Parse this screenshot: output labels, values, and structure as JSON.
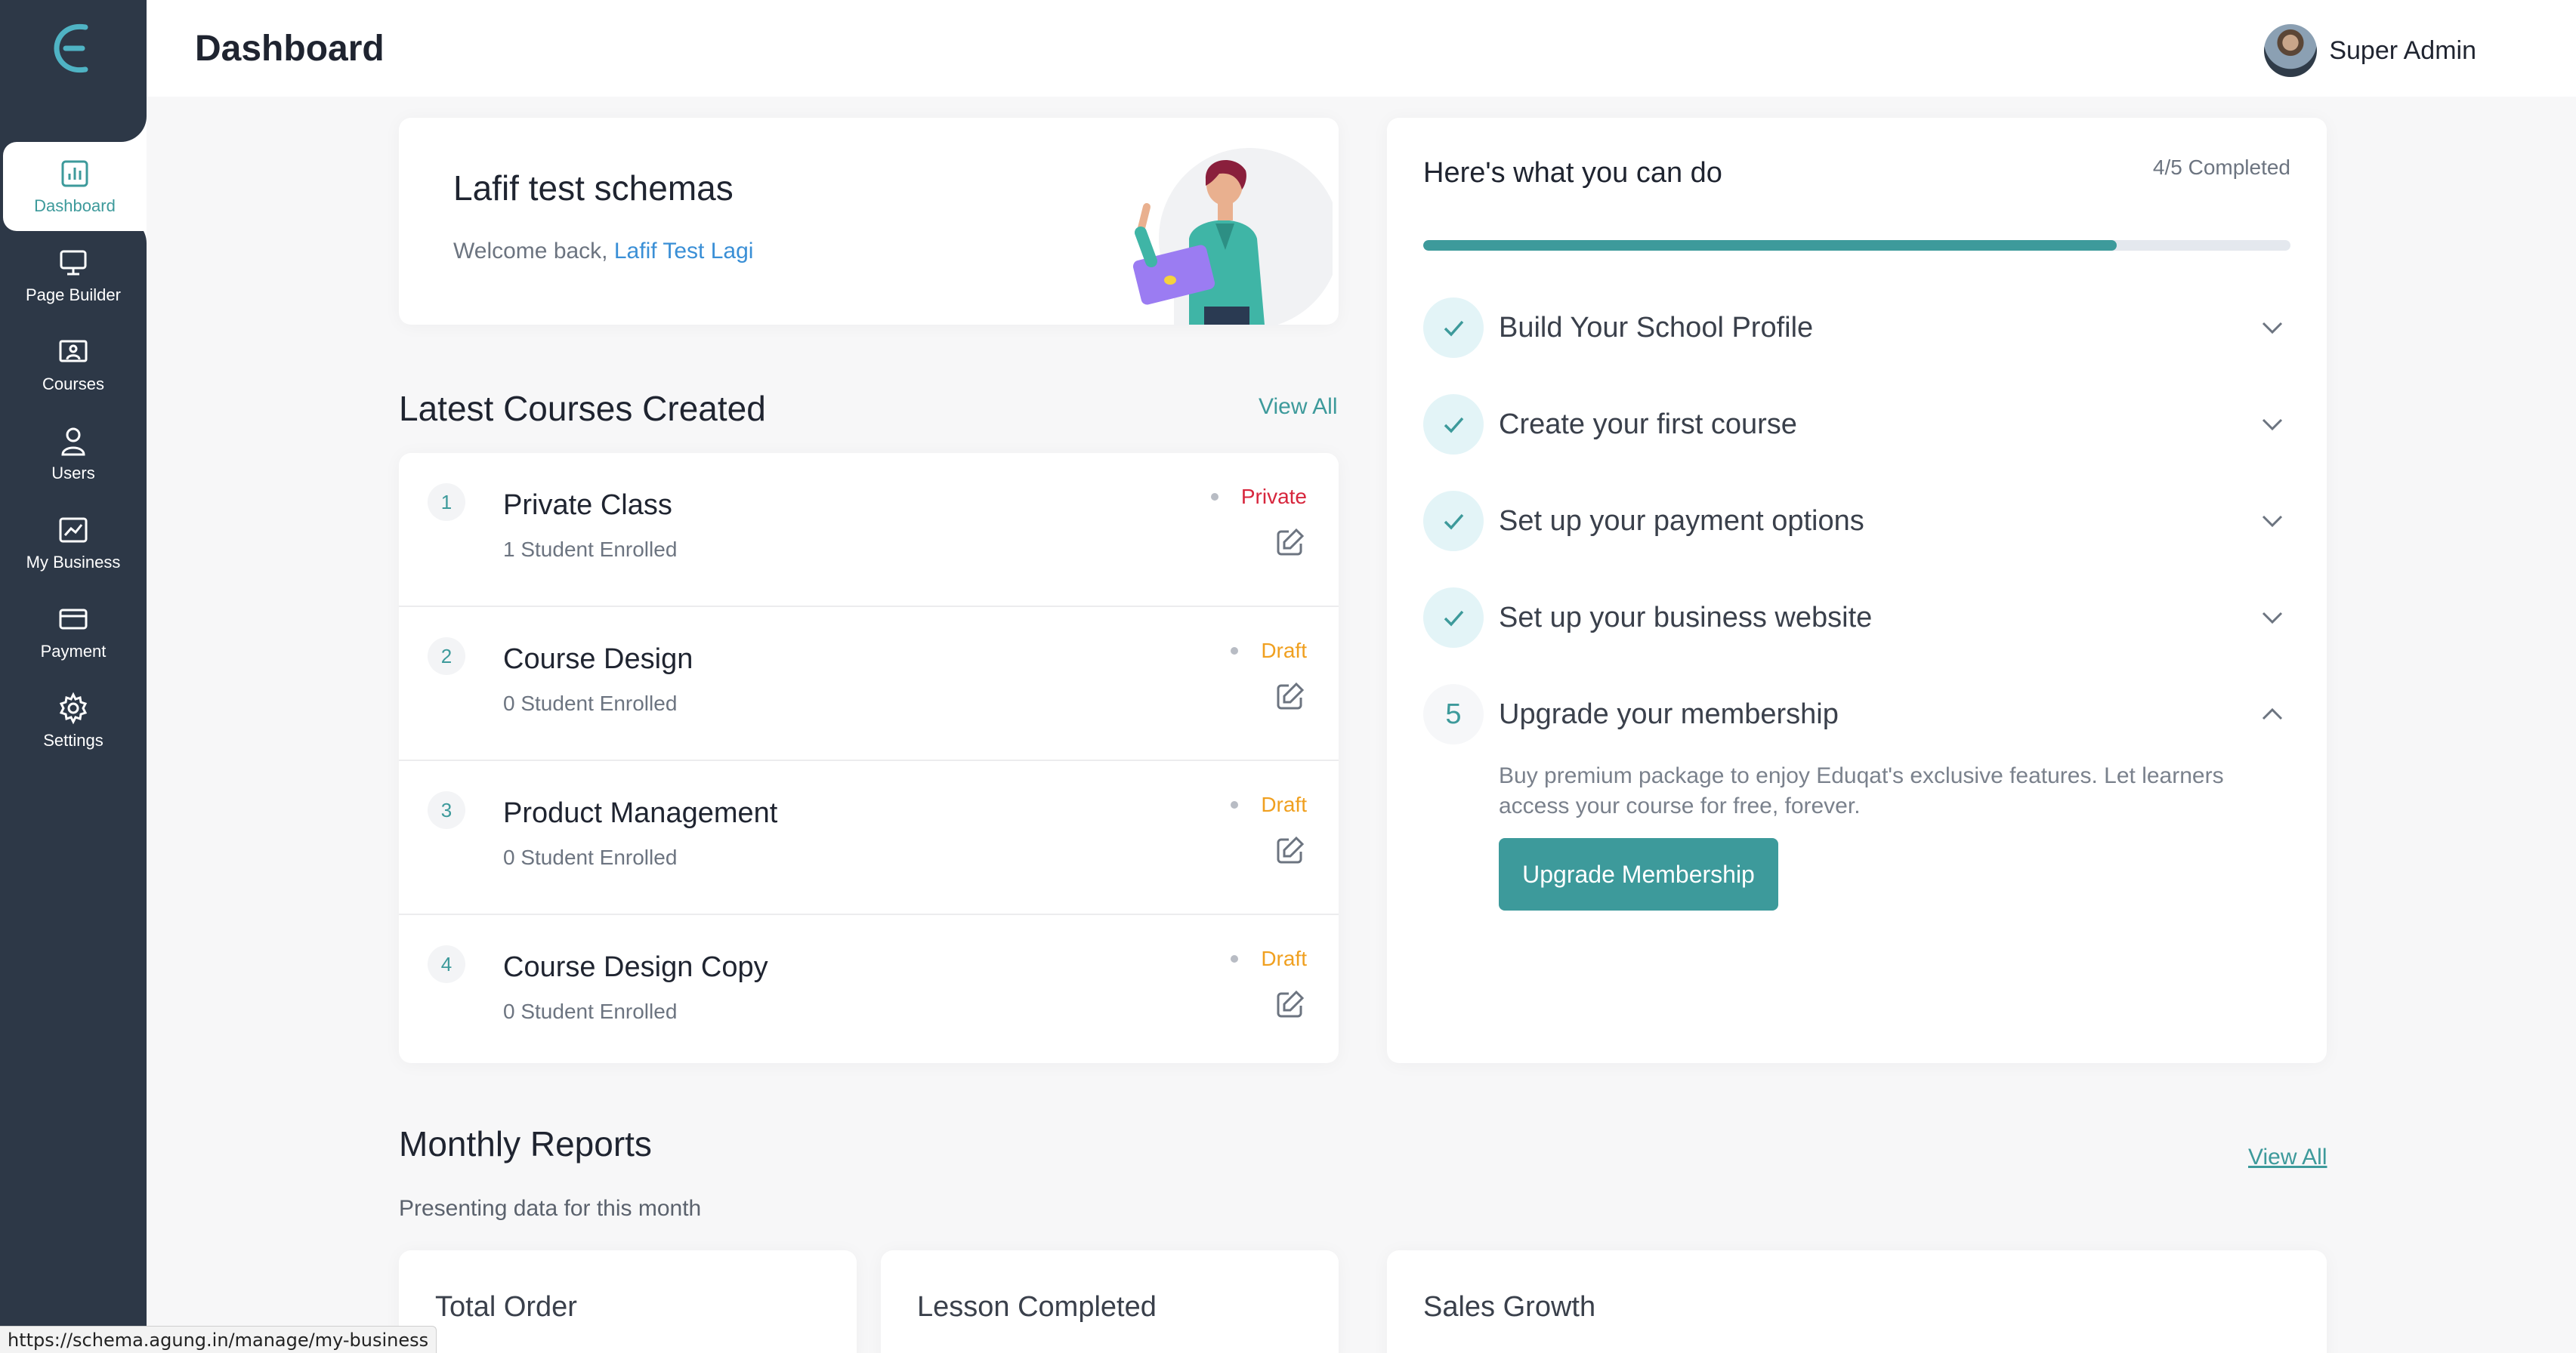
{
  "header": {
    "title": "Dashboard",
    "user_name": "Super Admin"
  },
  "sidebar": {
    "items": [
      {
        "label": "Dashboard",
        "icon": "chart-icon",
        "active": true
      },
      {
        "label": "Page Builder",
        "icon": "monitor-icon"
      },
      {
        "label": "Courses",
        "icon": "presentation-icon"
      },
      {
        "label": "Users",
        "icon": "user-icon"
      },
      {
        "label": "My Business",
        "icon": "trend-icon"
      },
      {
        "label": "Payment",
        "icon": "card-icon"
      },
      {
        "label": "Settings",
        "icon": "gear-icon"
      }
    ]
  },
  "welcome": {
    "school_name": "Lafif test schemas",
    "greeting": "Welcome back, ",
    "user": "Lafif Test Lagi"
  },
  "courses": {
    "title": "Latest Courses Created",
    "view_all": "View All",
    "items": [
      {
        "num": "1",
        "title": "Private Class",
        "enrolled": "1 Student Enrolled",
        "status": "Private"
      },
      {
        "num": "2",
        "title": "Course Design",
        "enrolled": "0 Student Enrolled",
        "status": "Draft"
      },
      {
        "num": "3",
        "title": "Product Management",
        "enrolled": "0 Student Enrolled",
        "status": "Draft"
      },
      {
        "num": "4",
        "title": "Course Design Copy",
        "enrolled": "0 Student Enrolled",
        "status": "Draft"
      }
    ]
  },
  "todo": {
    "title": "Here's what you can do",
    "completed_label": "4/5 Completed",
    "progress": 0.8,
    "tasks": [
      {
        "label": "Build Your School Profile",
        "done": true
      },
      {
        "label": "Create your first course",
        "done": true
      },
      {
        "label": "Set up your payment options",
        "done": true
      },
      {
        "label": "Set up your business website",
        "done": true
      },
      {
        "label": "Upgrade your membership",
        "done": false,
        "step": "5"
      }
    ],
    "upgrade_desc": "Buy premium package to enjoy Eduqat's exclusive features. Let learners access your course for free, forever.",
    "upgrade_button": "Upgrade Membership"
  },
  "reports": {
    "title": "Monthly Reports",
    "subtitle": "Presenting data for this month",
    "view_all": "View All",
    "cards": [
      "Total Order",
      "Lesson Completed",
      "Sales Growth"
    ]
  },
  "status_bar_url": "https://schema.agung.in/manage/my-business",
  "colors": {
    "sidebar": "#2d3847",
    "accent": "#3d9a9b",
    "private": "#d7263d",
    "draft": "#f0a020",
    "link": "#3a8fd6"
  }
}
